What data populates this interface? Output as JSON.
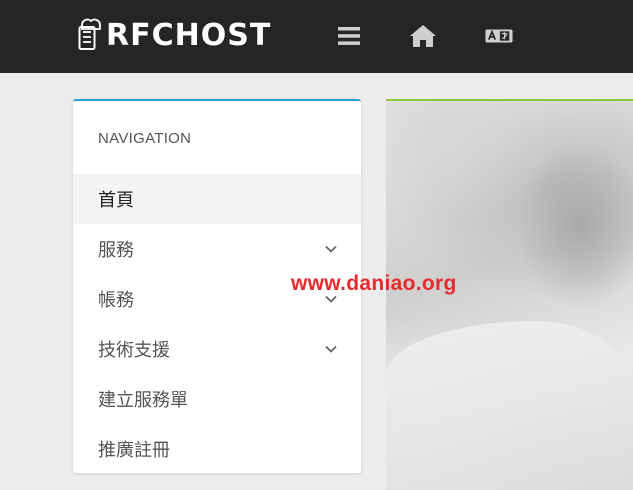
{
  "header": {
    "logo_text": "RFCHOST",
    "icons": [
      "server-icon",
      "menu-icon",
      "home-icon",
      "language-icon"
    ]
  },
  "navigation": {
    "title": "NAVIGATION",
    "items": [
      {
        "label": "首頁",
        "active": true,
        "has_submenu": false
      },
      {
        "label": "服務",
        "active": false,
        "has_submenu": true
      },
      {
        "label": "帳務",
        "active": false,
        "has_submenu": true
      },
      {
        "label": "技術支援",
        "active": false,
        "has_submenu": true
      },
      {
        "label": "建立服務單",
        "active": false,
        "has_submenu": false
      },
      {
        "label": "推廣註冊",
        "active": false,
        "has_submenu": false
      }
    ]
  },
  "watermark": "www.daniao.org",
  "colors": {
    "topbar": "#252525",
    "nav_accent": "#2a9fd6",
    "hero_accent": "#8cc63f",
    "watermark": "#e52b2b"
  }
}
